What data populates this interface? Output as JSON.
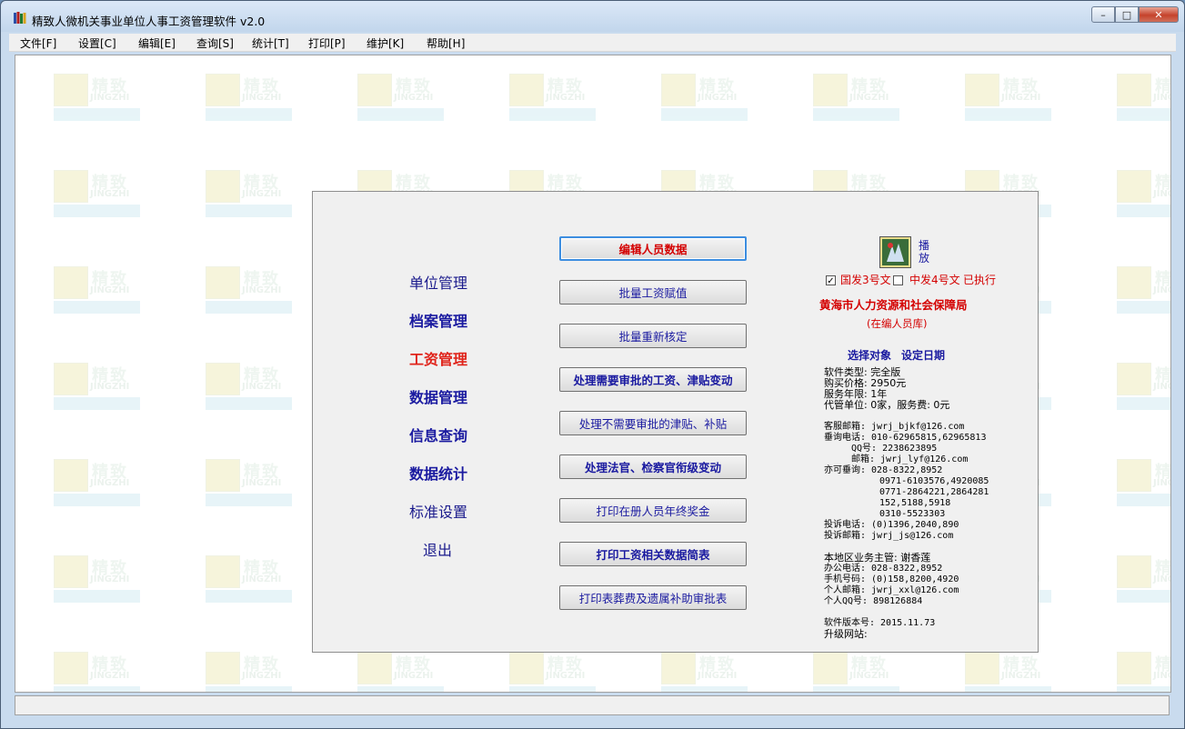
{
  "window": {
    "title": "精致人微机关事业单位人事工资管理软件 v2.0",
    "minimize": "–",
    "maximize": "□",
    "close": "✕"
  },
  "menu": [
    {
      "label": "文件[F]"
    },
    {
      "label": "设置[C]"
    },
    {
      "label": "编辑[E]"
    },
    {
      "label": "查询[S]"
    },
    {
      "label": "统计[T]"
    },
    {
      "label": "打印[P]"
    },
    {
      "label": "维护[K]"
    },
    {
      "label": "帮助[H]"
    }
  ],
  "watermark": {
    "text1": "精致",
    "text2": "JINGZHI"
  },
  "nav": [
    {
      "label": "单位管理"
    },
    {
      "label": "档案管理"
    },
    {
      "label": "工资管理"
    },
    {
      "label": "数据管理"
    },
    {
      "label": "信息查询"
    },
    {
      "label": "数据统计"
    },
    {
      "label": "标准设置"
    },
    {
      "label": "退出"
    }
  ],
  "buttons": [
    {
      "label": "编辑人员数据"
    },
    {
      "label": "批量工资赋值"
    },
    {
      "label": "批量重新核定"
    },
    {
      "label": "处理需要审批的工资、津贴变动"
    },
    {
      "label": "处理不需要审批的津贴、补贴"
    },
    {
      "label": "处理法官、检察官衔级变动"
    },
    {
      "label": "打印在册人员年终奖金"
    },
    {
      "label": "打印工资相关数据简表"
    },
    {
      "label": "打印表葬费及遗属补助审批表"
    }
  ],
  "info": {
    "play_label_1": "播",
    "play_label_2": "放",
    "checkbox1_label": "国发3号文",
    "checkbox2_label": "中发4号文",
    "executed": "已执行",
    "bureau": "黄海市人力资源和社会保障局",
    "staff_db": "(在编人员库)",
    "select_object": "选择对象",
    "set_date": "设定日期",
    "software_type": "软件类型: 完全版",
    "price": "购买价格: 2950元",
    "service_years": "服务年限: 1年",
    "agency": "代管单位: 0家，服务费: 0元",
    "service_email": "客服邮箱: jwrj_bjkf@126.com",
    "phone": "垂询电话: 010-62965815,62965813",
    "qq": "QQ号: 2238623895",
    "mail": "邮箱: jwrj_lyf@126.com",
    "also_phone_1": "亦可垂询: 028-8322,8952",
    "also_phone_2": "0971-6103576,4920085",
    "also_phone_3": "0771-2864221,2864281",
    "also_phone_4": "152,5188,5918",
    "also_phone_5": "0310-5523303",
    "complaint_phone": "投诉电话: (0)1396,2040,890",
    "complaint_email": "投诉邮箱: jwrj_js@126.com",
    "local_manager": "本地区业务主管: 谢香莲",
    "office_phone": "办公电话: 028-8322,8952",
    "mobile": "手机号码: (0)158,8200,4920",
    "personal_email": "个人邮箱: jwrj_xxl@126.com",
    "personal_qq": "个人QQ号: 898126884",
    "version": "软件版本号: 2015.11.73",
    "upgrade_site": "升级网站:"
  },
  "colors": {
    "accent_red": "#e0241b",
    "nav_blue": "#1a1aa0",
    "panel_bg": "#f0f0f0"
  }
}
